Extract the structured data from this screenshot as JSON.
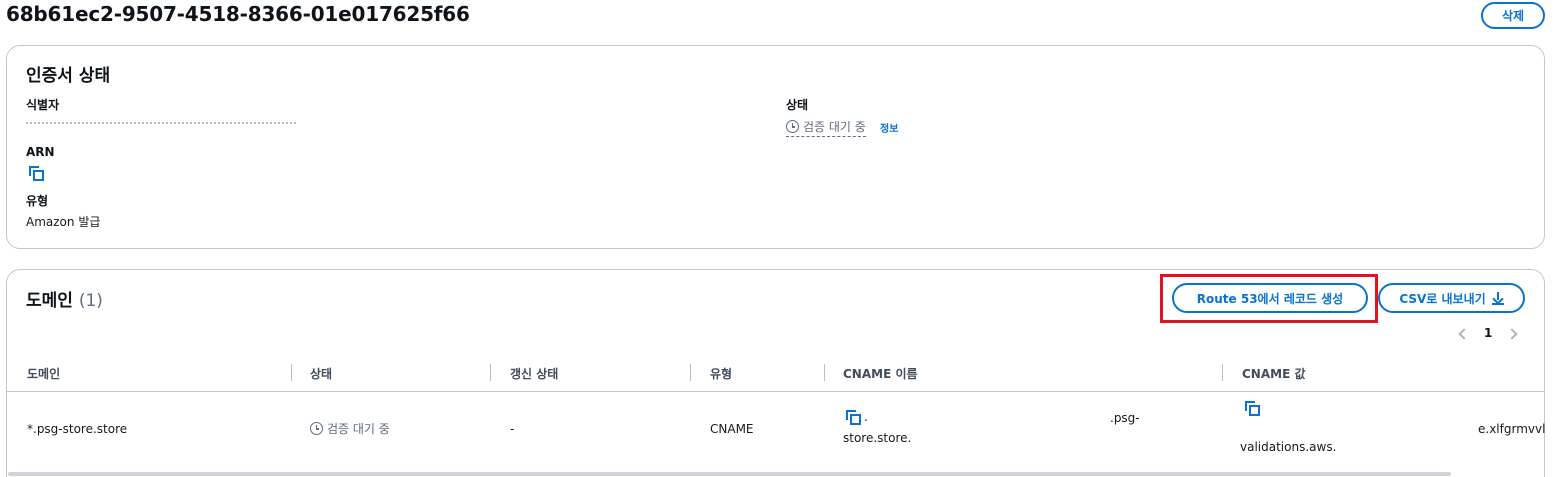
{
  "page": {
    "title": "68b61ec2-9507-4518-8366-01e017625f66",
    "delete_label": "삭제"
  },
  "certificate_status": {
    "heading": "인증서 상태",
    "identifier_label": "식별자",
    "status_label": "상태",
    "status_value": "검증 대기 중",
    "status_info_link": "정보",
    "arn_label": "ARN",
    "type_label": "유형",
    "type_value": "Amazon 발급"
  },
  "domains": {
    "heading": "도메인",
    "count": "(1)",
    "route53_button": "Route 53에서 레코드 생성",
    "csv_button": "CSV로 내보내기",
    "page_number": "1",
    "columns": [
      "도메인",
      "상태",
      "갱신 상태",
      "유형",
      "CNAME 이름",
      "CNAME 값"
    ],
    "rows": [
      {
        "domain": "*.psg-store.store",
        "status": "검증 대기 중",
        "renewal_status": "-",
        "type": "CNAME",
        "cname_name_part1": ".",
        "cname_name_part2": ".psg-",
        "cname_name_part3": "store.store.",
        "cname_value_part1": "validations.aws.",
        "cname_value_part2": "e.xlfgrmvvl"
      }
    ]
  },
  "colors": {
    "accent": "#0972d3",
    "highlight": "#e0141e",
    "pending": "#5f6b7a"
  },
  "icons": [
    "copy-icon",
    "clock-icon",
    "download-icon",
    "chevron-left-icon",
    "chevron-right-icon"
  ]
}
